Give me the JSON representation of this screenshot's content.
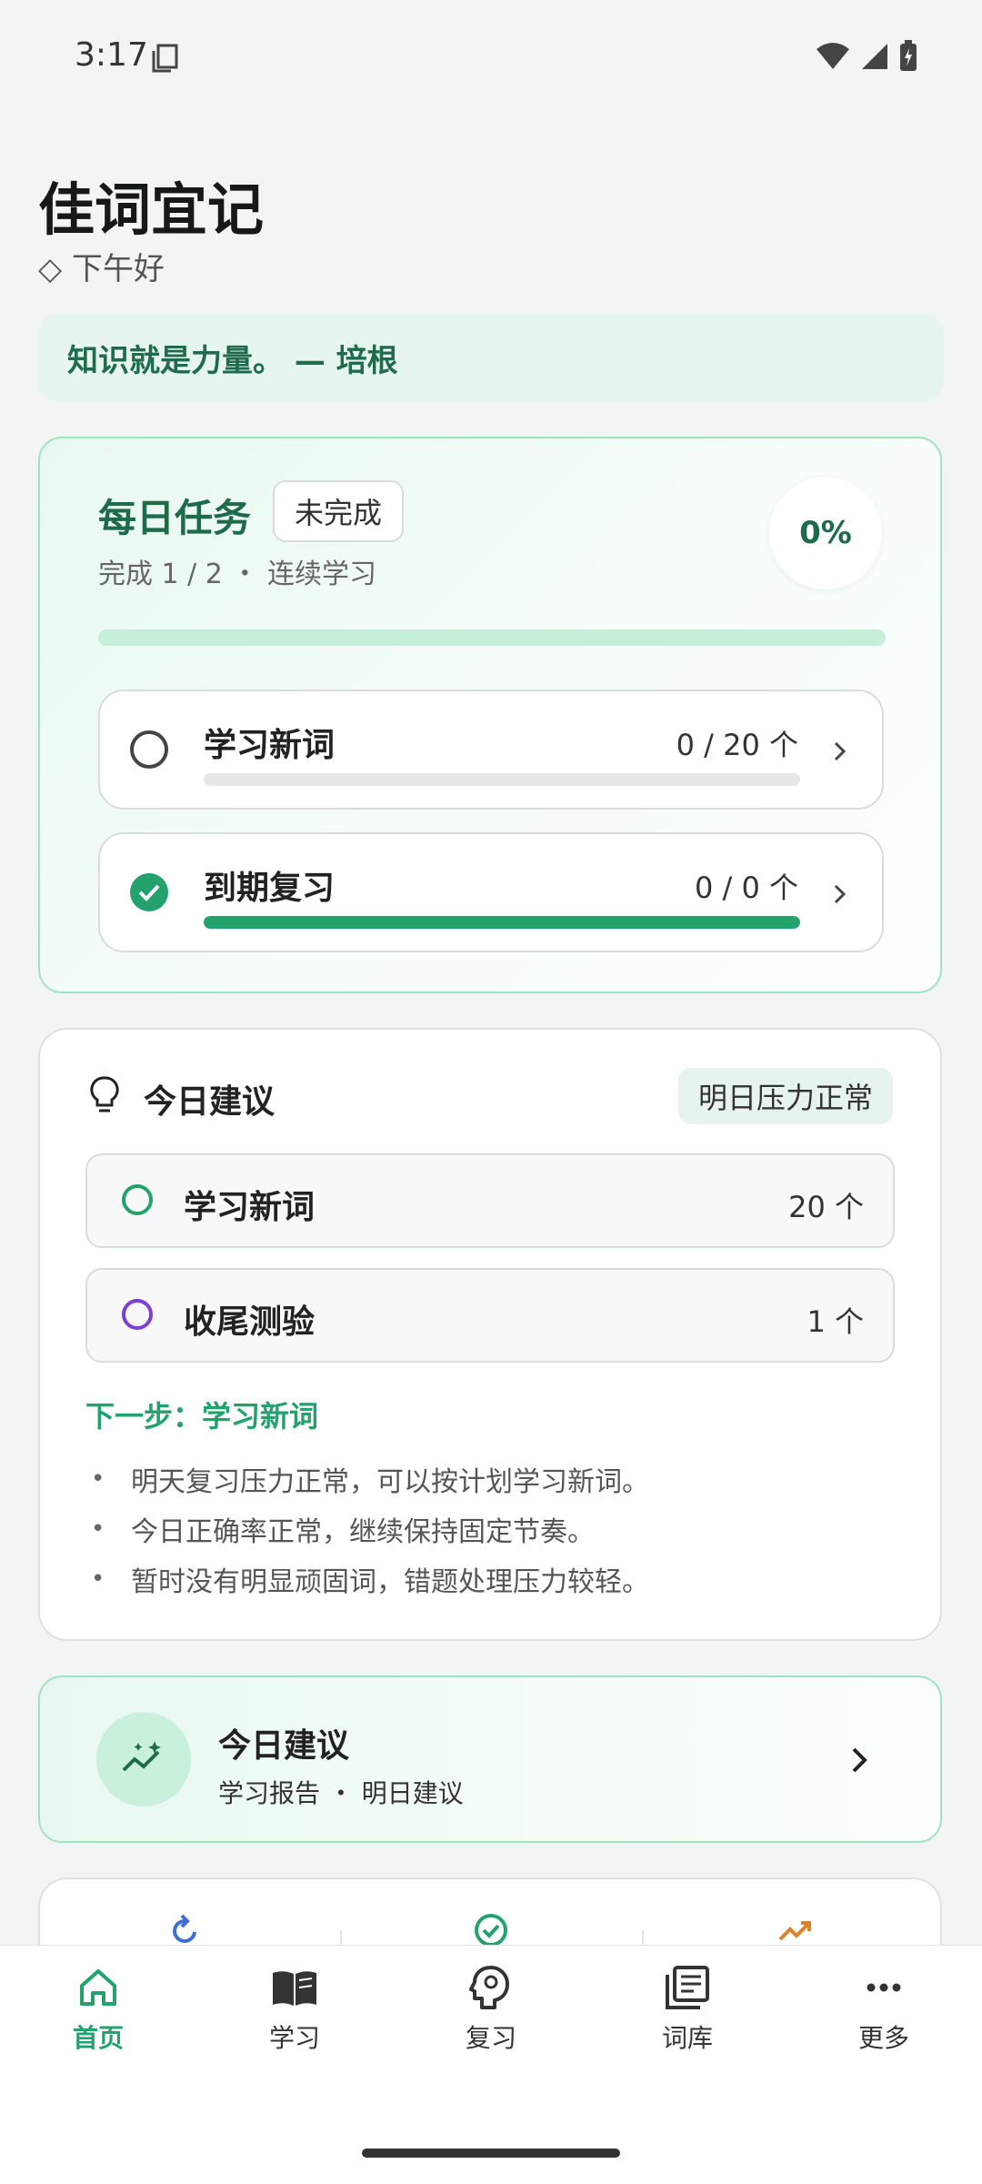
{
  "status_bar": {
    "time": "3:17"
  },
  "header": {
    "title": "佳词宜记",
    "greeting": "◇ 下午好"
  },
  "quote": "知识就是力量。 — 培根",
  "daily_task": {
    "title": "每日任务",
    "badge": "未完成",
    "summary": "完成 1 / 2 ・ 连续学习",
    "percent": "0%",
    "items": [
      {
        "label": "学习新词",
        "count": "0 / 20 个",
        "done": false,
        "progress": 0
      },
      {
        "label": "到期复习",
        "count": "0 / 0 个",
        "done": true,
        "progress": 1
      }
    ]
  },
  "suggestion": {
    "title": "今日建议",
    "pressure_badge": "明日压力正常",
    "items": [
      {
        "label": "学习新词",
        "count": "20 个",
        "ring_color": "#23a26d"
      },
      {
        "label": "收尾测验",
        "count": "1 个",
        "ring_color": "#7b3fd6"
      }
    ],
    "next_step": "下一步：学习新词",
    "tips": [
      "明天复习压力正常，可以按计划学习新词。",
      "今日正确率正常，继续保持固定节奏。",
      "暂时没有明显顽固词，错题处理压力较轻。"
    ]
  },
  "report_card": {
    "title": "今日建议",
    "subtitle": "学习报告 ・ 明日建议"
  },
  "nav": [
    {
      "label": "首页",
      "icon": "home-icon",
      "active": true
    },
    {
      "label": "学习",
      "icon": "book-icon",
      "active": false
    },
    {
      "label": "复习",
      "icon": "brain-icon",
      "active": false
    },
    {
      "label": "词库",
      "icon": "library-icon",
      "active": false
    },
    {
      "label": "更多",
      "icon": "more-icon",
      "active": false
    }
  ],
  "colors": {
    "accent": "#23a26d",
    "accent_dark": "#1e6b4a",
    "purple": "#7b3fd6",
    "orange": "#d9822b"
  }
}
